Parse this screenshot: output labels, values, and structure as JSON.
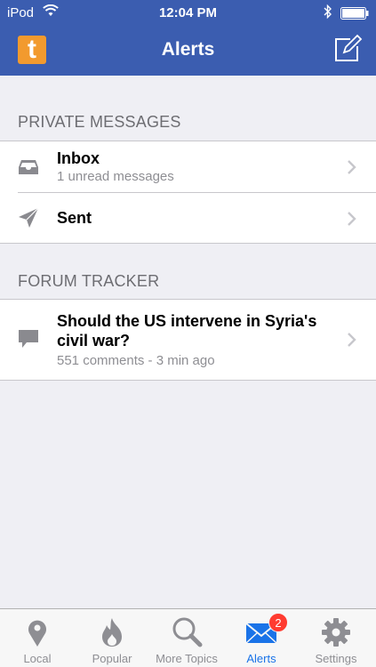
{
  "status_bar": {
    "carrier": "iPod",
    "time": "12:04 PM"
  },
  "nav": {
    "logo_letter": "t",
    "title": "Alerts"
  },
  "sections": {
    "private_messages": {
      "header": "PRIVATE MESSAGES",
      "items": [
        {
          "title": "Inbox",
          "subtitle": "1 unread messages"
        },
        {
          "title": "Sent"
        }
      ]
    },
    "forum_tracker": {
      "header": "FORUM TRACKER",
      "items": [
        {
          "title_line1": "Should the US intervene in Syria's",
          "title_line2": "civil war?",
          "subtitle": "551 comments - 3 min ago"
        }
      ]
    }
  },
  "tabbar": {
    "tabs": [
      {
        "label": "Local",
        "icon": "location-pin-icon"
      },
      {
        "label": "Popular",
        "icon": "flame-icon"
      },
      {
        "label": "More Topics",
        "icon": "magnifier-icon"
      },
      {
        "label": "Alerts",
        "icon": "envelope-icon",
        "badge": "2"
      },
      {
        "label": "Settings",
        "icon": "gear-icon"
      }
    ],
    "active_index": 3
  },
  "colors": {
    "header_blue": "#3b5db0",
    "logo_orange": "#f29a2e",
    "active_tab": "#1a73e8",
    "badge_red": "#ff3b30"
  }
}
